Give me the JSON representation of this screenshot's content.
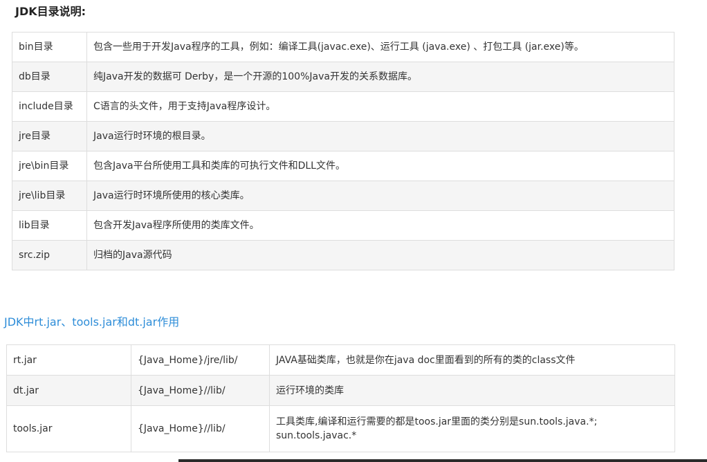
{
  "heading1": "JDK目录说明:",
  "table1": [
    {
      "name": "bin目录",
      "desc": "包含一些用于开发Java程序的工具，例如：编译工具(javac.exe)、运行工具 (java.exe) 、打包工具 (jar.exe)等。"
    },
    {
      "name": "db目录",
      "desc": "纯Java开发的数据可 Derby，是一个开源的100%Java开发的关系数据库。"
    },
    {
      "name": "include目录",
      "desc": "C语言的头文件，用于支持Java程序设计。"
    },
    {
      "name": "jre目录",
      "desc": "Java运行时环境的根目录。"
    },
    {
      "name": "jre\\bin目录",
      "desc": "包含Java平台所使用工具和类库的可执行文件和DLL文件。"
    },
    {
      "name": "jre\\lib目录",
      "desc": "Java运行时环境所使用的核心类库。"
    },
    {
      "name": "lib目录",
      "desc": "包含开发Java程序所使用的类库文件。"
    },
    {
      "name": "src.zip",
      "desc": "归档的Java源代码"
    }
  ],
  "heading2": "JDK中rt.jar、tools.jar和dt.jar作用",
  "table2": [
    {
      "name": "rt.jar",
      "path": "{Java_Home}/jre/lib/",
      "desc": "JAVA基础类库，也就是你在java doc里面看到的所有的类的class文件"
    },
    {
      "name": "dt.jar",
      "path": "{Java_Home}//lib/",
      "desc": "运行环境的类库"
    },
    {
      "name": "tools.jar",
      "path": "{Java_Home}//lib/",
      "desc": "工具类库,编译和运行需要的都是toos.jar里面的类分别是sun.tools.java.*; sun.tools.javac.*"
    }
  ]
}
